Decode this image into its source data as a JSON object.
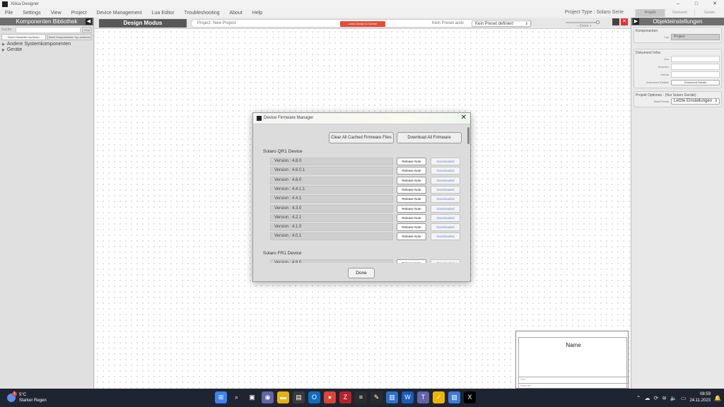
{
  "window": {
    "title": "Xilica Designer",
    "controls": [
      "–",
      "□",
      "✕"
    ]
  },
  "menu": [
    "File",
    "Settings",
    "View",
    "Project",
    "Device Management",
    "Lua Editor",
    "Troubleshooting",
    "About",
    "Help"
  ],
  "project_type": "Project Type : Solaro Serie",
  "right_tabs": [
    "Projekt",
    "Netzwerk",
    "Geräte"
  ],
  "left_panel": {
    "title": "Komponenten Bibliothek",
    "search_label": "Suche",
    "search_value": "",
    "search_button": "Find",
    "sort_buttons": [
      "Nach Hersteller sortieren",
      "Nach Komponenten Typ sortieren"
    ],
    "tree": [
      "Andere Systemkomponenten",
      "Geräte"
    ]
  },
  "toolbar": {
    "mode": "Design Modus",
    "project_name": "Project: New Project",
    "load_design": "Lade Design in Geräte",
    "preset_label": "Kein Preset activ",
    "preset_value": "Kein Preset definiert",
    "zoom_label": "Zoom",
    "zoom_value": 0.9,
    "close_glyph": "✕"
  },
  "right_panel": {
    "title": "Objekteinstellungen",
    "components": {
      "title": "Komponenten",
      "type_label": "Typ",
      "type_value": "Project"
    },
    "document_info": {
      "title": "Dokument Infos",
      "fields": [
        {
          "label": "Von",
          "value": ""
        },
        {
          "label": "Nummer",
          "value": ""
        },
        {
          "label": "Datum",
          "value": ""
        }
      ],
      "details_label": "Dokument Details",
      "details_button": "Dokument Details"
    },
    "project_options": {
      "title": "Projekt Optionen - (Nur Solaro Geräte)",
      "start_preset_label": "Start-Preset",
      "start_preset_value": "Letzte Einstellungen"
    }
  },
  "name_box": {
    "name_label": "Name",
    "line1": "Von",
    "line2": "Nummer"
  },
  "dialog": {
    "title": "Device Firmware Manager",
    "close_glyph": "✕",
    "clear_button": "Clear All Cached Firmware Files",
    "download_all_button": "Download All Firmware",
    "release_note_label": "Release Note",
    "downloaded_label": "Downloaded",
    "groups": [
      {
        "name": "Solaro QR1 Device",
        "versions": [
          "Version : 4.8.0",
          "Version : 4.6.0.1",
          "Version : 4.6.0",
          "Version : 4.4.1.1",
          "Version : 4.4.1",
          "Version : 4.3.0",
          "Version : 4.2.1",
          "Version : 4.1.0",
          "Version : 4.0.1"
        ]
      },
      {
        "name": "Solaro FR1 Device",
        "versions": [
          "Version : 4.8.0"
        ]
      }
    ],
    "done_button": "Done"
  },
  "taskbar": {
    "weather_temp": "5°C",
    "weather_condition": "Starker Regen",
    "weather_badge": "1",
    "apps": [
      {
        "name": "start-icon",
        "glyph": "⊞",
        "color": "#3b82f6"
      },
      {
        "name": "search-icon",
        "glyph": "⌕",
        "color": "#1f2530"
      },
      {
        "name": "task-view-icon",
        "glyph": "▣",
        "color": "#1f2530"
      },
      {
        "name": "teams-chat-icon",
        "glyph": "◉",
        "color": "#6264a7"
      },
      {
        "name": "file-explorer-icon",
        "glyph": "▬",
        "color": "#e8b10e"
      },
      {
        "name": "notepad-icon",
        "glyph": "▤",
        "color": "#3a3a3a"
      },
      {
        "name": "outlook-icon",
        "glyph": "O",
        "color": "#0f6cbd"
      },
      {
        "name": "chrome-icon",
        "glyph": "●",
        "color": "#db4437"
      },
      {
        "name": "filezilla-icon",
        "glyph": "Z",
        "color": "#b8212a"
      },
      {
        "name": "text-editor-icon",
        "glyph": "≡",
        "color": "#2b2b2b"
      },
      {
        "name": "pen-tool-icon",
        "glyph": "✎",
        "color": "#2b2b2b"
      },
      {
        "name": "notes-icon",
        "glyph": "▥",
        "color": "#2d6fc9"
      },
      {
        "name": "word-icon",
        "glyph": "W",
        "color": "#185abd"
      },
      {
        "name": "teams-icon",
        "glyph": "T",
        "color": "#6264a7"
      },
      {
        "name": "norton-icon",
        "glyph": "✓",
        "color": "#f0b400"
      },
      {
        "name": "photos-icon",
        "glyph": "▨",
        "color": "#3d7bd9"
      },
      {
        "name": "xilica-icon",
        "glyph": "X",
        "color": "#000000"
      }
    ],
    "tray_icons": [
      "chevron-up-icon",
      "cloud-icon",
      "sync-icon",
      "wifi-icon",
      "speaker-icon",
      "battery-icon"
    ],
    "time": "08:59",
    "date": "24.11.2023"
  }
}
